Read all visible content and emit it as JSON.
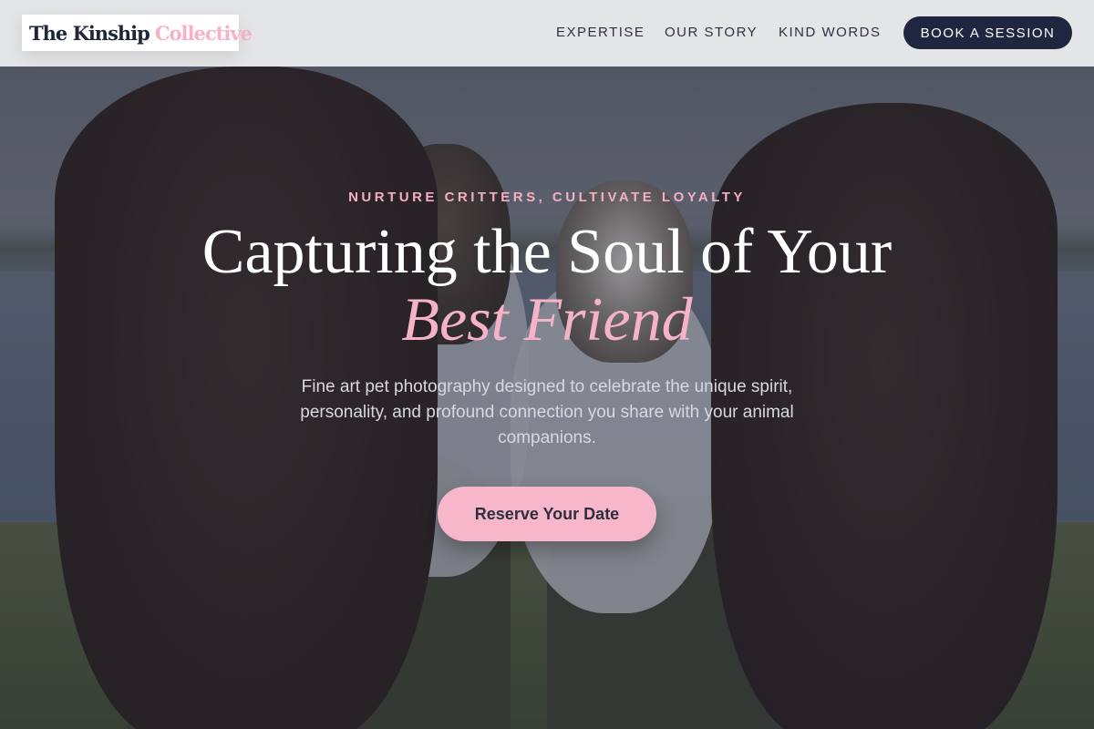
{
  "brand": {
    "name_main": "The Kinship",
    "name_accent": "Collective",
    "accent_color": "#f5b2c6",
    "primary_color": "#1f2740"
  },
  "nav": {
    "links": [
      {
        "label": "EXPERTISE"
      },
      {
        "label": "OUR STORY"
      },
      {
        "label": "KIND WORDS"
      }
    ],
    "cta_label": "BOOK A SESSION"
  },
  "hero": {
    "tagline": "NURTURE CRITTERS, CULTIVATE LOYALTY",
    "headline": "Capturing the Soul of Your",
    "headline_accent": "Best Friend",
    "subtext": "Fine art pet photography designed to celebrate the unique spirit, personality, and profound connection you share with your animal companions.",
    "cta_label": "Reserve Your Date"
  }
}
